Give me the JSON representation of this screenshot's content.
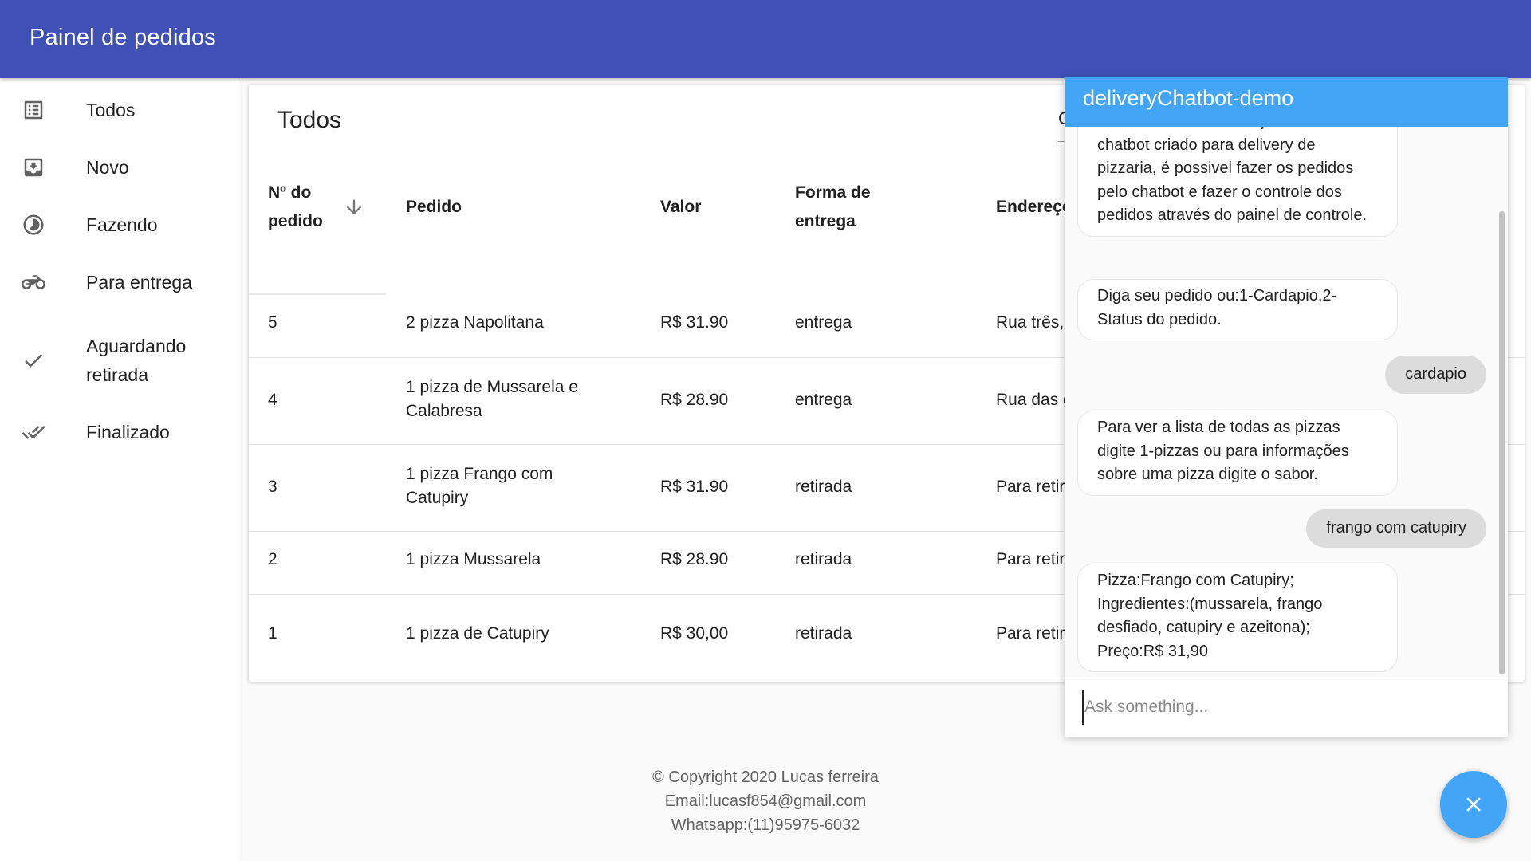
{
  "app": {
    "title": "Painel de pedidos"
  },
  "sidebar": {
    "items": [
      {
        "label": "Todos",
        "icon": "list-alt-icon"
      },
      {
        "label": "Novo",
        "icon": "inbox-download-icon"
      },
      {
        "label": "Fazendo",
        "icon": "timelapse-icon"
      },
      {
        "label": "Para entrega",
        "icon": "motorcycle-icon"
      },
      {
        "label": "Aguardando retirada",
        "icon": "check-icon"
      },
      {
        "label": "Finalizado",
        "icon": "done-all-icon"
      }
    ]
  },
  "orders": {
    "title": "Todos",
    "search_partial": "C",
    "columns": {
      "number": "Nº do pedido",
      "order": "Pedido",
      "value": "Valor",
      "delivery": "Forma de entrega",
      "address": "Endereço"
    },
    "rows": [
      {
        "number": "5",
        "order": "2 pizza Napolitana",
        "value": "R$ 31.90",
        "delivery": "entrega",
        "address": "Rua três,"
      },
      {
        "number": "4",
        "order": "1 pizza de Mussarela e Calabresa",
        "value": "R$ 28.90",
        "delivery": "entrega",
        "address": "Rua das g"
      },
      {
        "number": "3",
        "order": "1 pizza Frango com Catupiry",
        "value": "R$ 31.90",
        "delivery": "retirada",
        "address": "Para retir"
      },
      {
        "number": "2",
        "order": "1 pizza Mussarela",
        "value": "R$ 28.90",
        "delivery": "retirada",
        "address": "Para retir"
      },
      {
        "number": "1",
        "order": "1 pizza de Catupiry",
        "value": "R$ 30,00",
        "delivery": "retirada",
        "address": "Para retir"
      }
    ]
  },
  "footer": {
    "copyright": "© Copyright 2020 Lucas ferreira",
    "email": "Email:lucasf854@gmail.com",
    "whatsapp": "Whatsapp:(11)95975-6032"
  },
  "chat": {
    "title": "deliveryChatbot-demo",
    "messages": [
      {
        "from": "bot",
        "text": "Esta é uma demonstração de um chatbot criado para delivery de pizzaria, é possivel fazer os pedidos pelo chatbot e fazer o controle dos pedidos através do painel de controle."
      },
      {
        "from": "bot",
        "text": "Diga seu pedido ou:1-Cardapio,2-Status do pedido."
      },
      {
        "from": "user",
        "text": "cardapio"
      },
      {
        "from": "bot",
        "text": "Para ver a lista de todas as pizzas digite 1-pizzas ou para informações sobre uma pizza digite o sabor."
      },
      {
        "from": "user",
        "text": "frango com catupiry"
      },
      {
        "from": "bot",
        "text": "Pizza:Frango com Catupiry; Ingredientes:(mussarela, frango desfiado, catupiry e azeitona); Preço:R$ 31,90"
      }
    ],
    "input_placeholder": "Ask something..."
  },
  "colors": {
    "appbar": "#3f51b5",
    "chat_accent": "#42a5f5",
    "user_bubble": "#dcdcdc"
  }
}
